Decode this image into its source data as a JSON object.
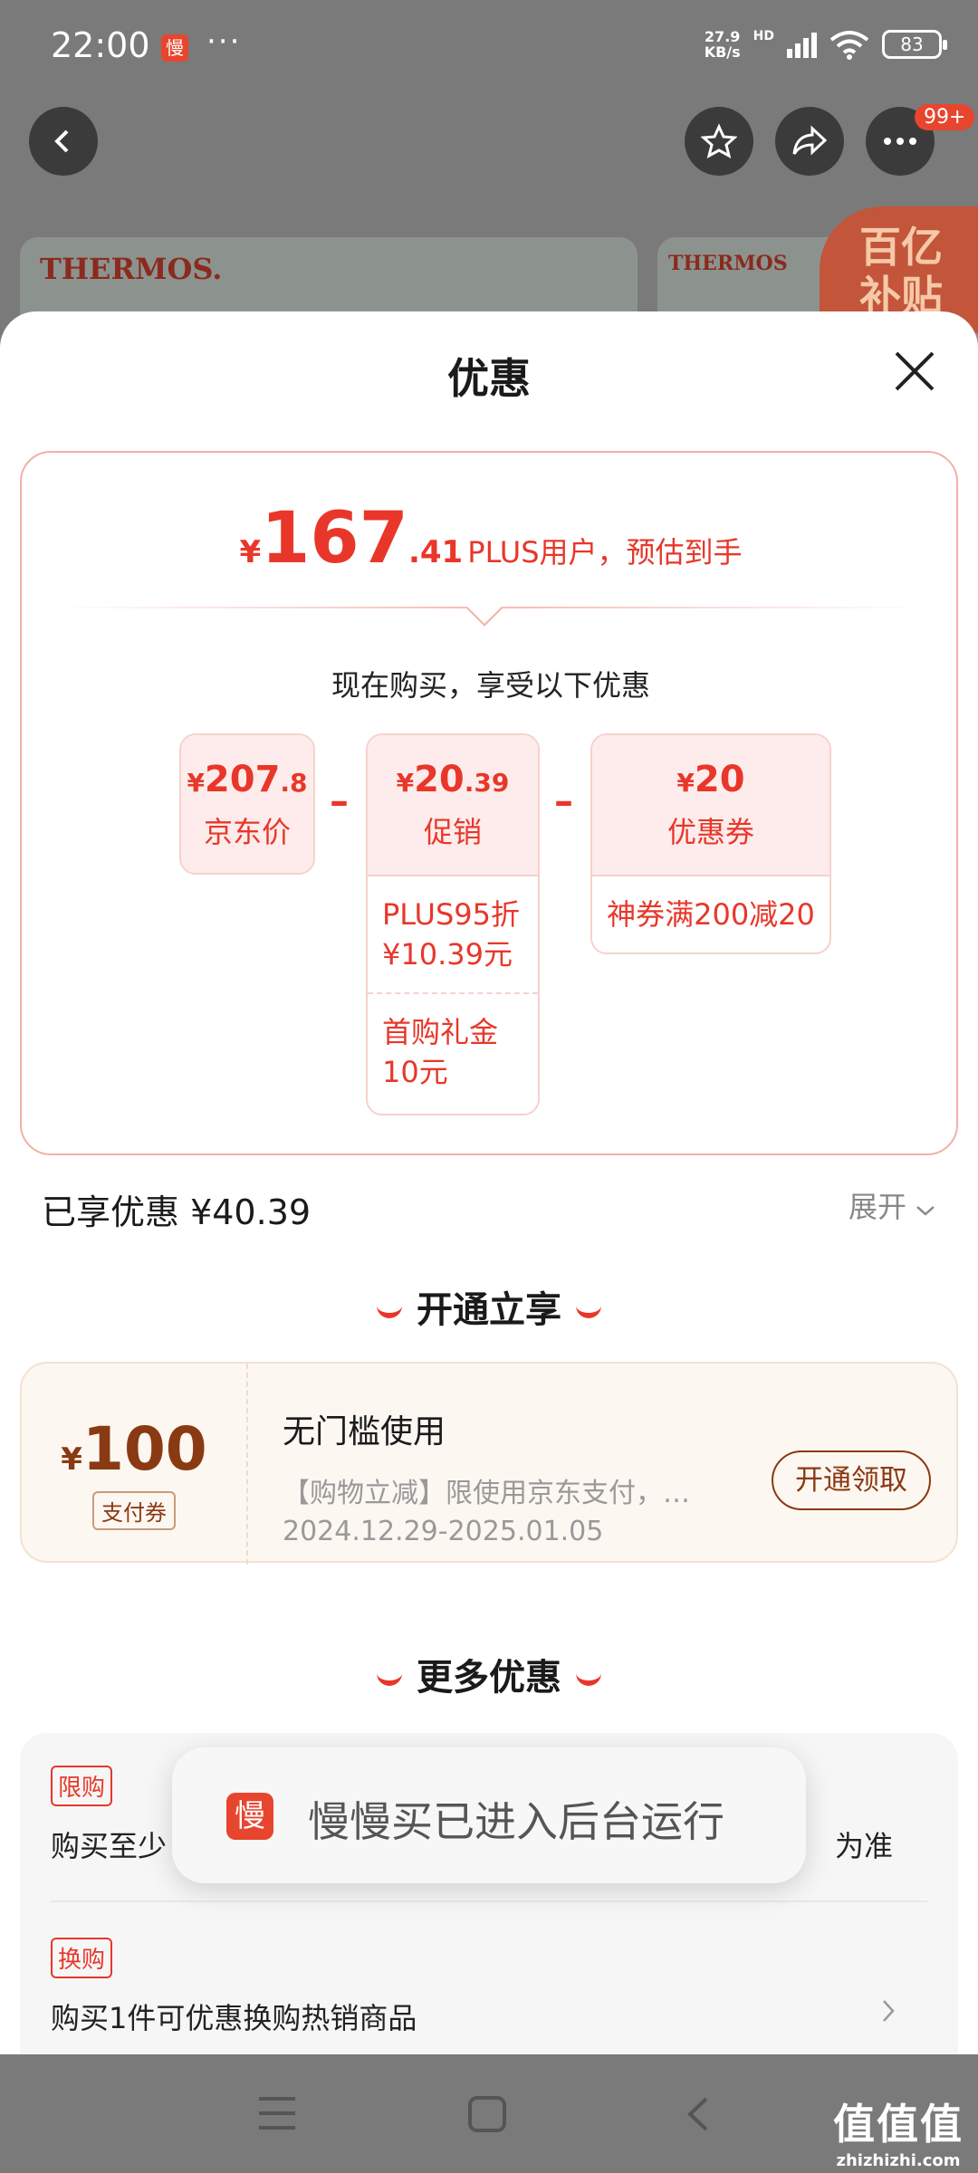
{
  "status_bar": {
    "time": "22:00",
    "app_icon_char": "慢",
    "dots": "···",
    "net_speed_value": "27.9",
    "net_speed_unit": "KB/s",
    "network": "HD",
    "battery": "83"
  },
  "top_nav": {
    "badge": "99+",
    "icons": [
      "back-icon",
      "star-icon",
      "share-icon",
      "more-icon"
    ]
  },
  "background": {
    "brand": "THERMOS.",
    "brand2": "THERMOS",
    "subsidy_line1": "百亿",
    "subsidy_line2": "补贴"
  },
  "sheet": {
    "title": "优惠",
    "price": {
      "currency": "¥",
      "integer": "167",
      "decimal": ".41",
      "note": "PLUS用户，预估到手"
    },
    "now_buy": "现在购买，享受以下优惠",
    "breakdown": [
      {
        "currency": "¥",
        "integer": "207",
        "decimal": ".8",
        "label": "京东价",
        "items": []
      },
      {
        "currency": "¥",
        "integer": "20",
        "decimal": ".39",
        "label": "促销",
        "items": [
          "PLUS95折 ¥10.39元",
          "首购礼金 10元"
        ]
      },
      {
        "currency": "¥",
        "integer": "20",
        "decimal": "",
        "label": "优惠券",
        "items": [
          "神券满200减20"
        ]
      }
    ],
    "operators": [
      "–",
      "–"
    ],
    "enjoyed": "已享优惠 ¥40.39",
    "expand": "展开",
    "open_section_title": "开通立享",
    "coupon": {
      "currency": "¥",
      "amount": "100",
      "type": "支付券",
      "title": "无门槛使用",
      "desc": "【购物立减】限使用京东支付，…",
      "date": "2024.12.29-2025.01.05",
      "button": "开通领取"
    },
    "more_section_title": "更多优惠",
    "more": [
      {
        "tag": "限购",
        "text_left": "购买至少",
        "text_right": "为准"
      },
      {
        "tag": "换购",
        "text": "购买1件可优惠换购热销商品"
      }
    ]
  },
  "toast": {
    "icon_char": "慢",
    "text": "慢慢买已进入后台运行"
  },
  "watermark": {
    "big": "值值值",
    "small": "zhizhizhi.com"
  },
  "colors": {
    "accent_red": "#e8372a",
    "coupon_brown": "#8a3a12",
    "overlay_gray": "#7a7a7a"
  }
}
